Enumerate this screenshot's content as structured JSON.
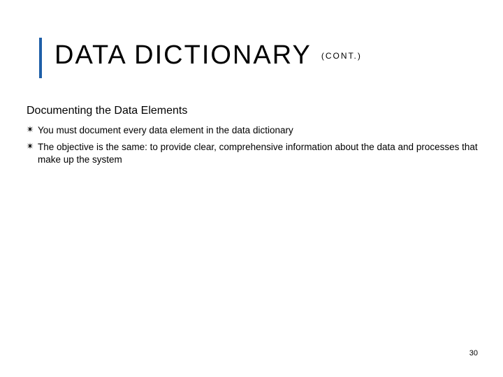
{
  "title": "DATA DICTIONARY",
  "title_cont": "(CONT.)",
  "subtitle": "Documenting the Data Elements",
  "bullets": [
    "You must document every data element in the data dictionary",
    "The objective is the same: to provide clear, comprehensive information about the data and processes that make up the system"
  ],
  "page_number": "30"
}
